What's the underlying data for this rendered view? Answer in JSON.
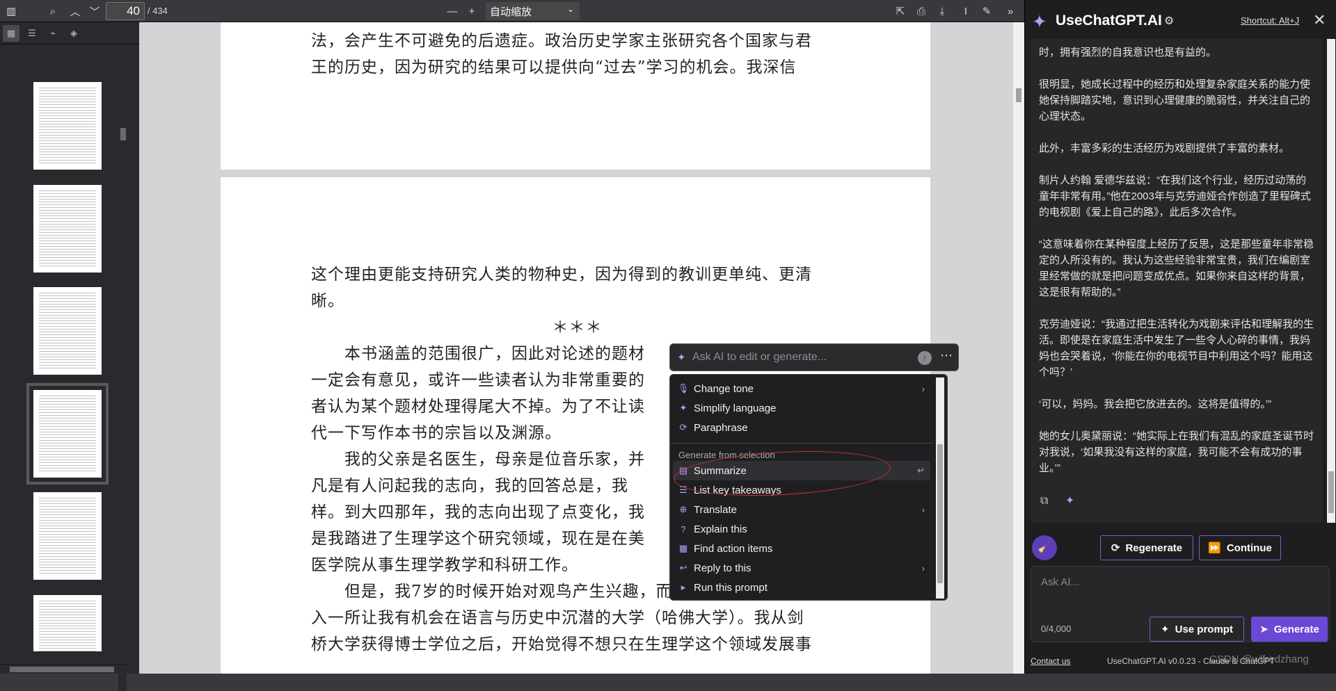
{
  "toolbar": {
    "page_number": "40",
    "page_total": "/ 434",
    "zoom_value": "自动缩放",
    "zoom_out": "—",
    "zoom_in": "+"
  },
  "page1": {
    "lines": [
      "法，会产生不可避免的后遗症。政治历史学家主张研究各个国家与君",
      "王的历史，因为研究的结果可以提供向“过去”学习的机会。我深信"
    ]
  },
  "page2": {
    "lines": [
      "这个理由更能支持研究人类的物种史，因为得到的教训更单纯、更清",
      "晰。",
      "＊＊＊",
      "　　本书涵盖的范围很广，因此对论述的题材",
      "一定会有意见，或许一些读者认为非常重要的",
      "者认为某个题材处理得尾大不掉。为了不让读",
      "代一下写作本书的宗旨以及渊源。",
      "　　我的父亲是名医生，母亲是位音乐家，并",
      "凡是有人问起我的志向，我的回答总是，我",
      "样。到大四那年，我的志向出现了点变化，我",
      "是我踏进了生理学这个研究领域，现在是在美",
      "医学院从事生理学教学和科研工作。",
      "　　但是，我7岁的时候开始对观鸟产生兴趣，而且很幸运地，后来进",
      "入一所让我有机会在语言与历史中沉潜的大学（哈佛大学）。我从剑",
      "桥大学获得博士学位之后，开始觉得不想只在生理学这个领域发展事"
    ]
  },
  "ai_bar": {
    "placeholder": "Ask AI to edit or generate..."
  },
  "menu": {
    "items_top": [
      {
        "label": "Change tone",
        "icon": "microphone-icon",
        "submenu": true
      },
      {
        "label": "Simplify language",
        "icon": "sparkle-icon",
        "submenu": false
      },
      {
        "label": "Paraphrase",
        "icon": "refresh-icon",
        "submenu": false
      }
    ],
    "group_label": "Generate from selection",
    "items_bottom": [
      {
        "label": "Summarize",
        "icon": "document-icon",
        "submenu": false
      },
      {
        "label": "List key takeaways",
        "icon": "list-icon",
        "submenu": false
      },
      {
        "label": "Translate",
        "icon": "globe-icon",
        "submenu": true
      },
      {
        "label": "Explain this",
        "icon": "question-icon",
        "submenu": false
      },
      {
        "label": "Find action items",
        "icon": "checklist-icon",
        "submenu": false
      },
      {
        "label": "Reply to this",
        "icon": "reply-icon",
        "submenu": true
      },
      {
        "label": "Run this prompt",
        "icon": "play-icon",
        "submenu": false
      }
    ]
  },
  "panel": {
    "title": "UseChatGPT.AI",
    "shortcut": "Shortcut: Alt+J",
    "messages": [
      "时，拥有强烈的自我意识也是有益的。",
      "很明显，她成长过程中的经历和处理复杂家庭关系的能力使她保持脚踏实地，意识到心理健康的脆弱性，并关注自己的心理状态。",
      "此外，丰富多彩的生活经历为戏剧提供了丰富的素材。",
      "制片人约翰 爱德华兹说：“在我们这个行业，经历过动荡的童年非常有用。”他在2003年与克劳迪娅合作创造了里程碑式的电视剧《爱上自己的路》，此后多次合作。",
      "“这意味着你在某种程度上经历了反思，这是那些童年非常稳定的人所没有的。我认为这些经验非常宝贵，我们在编剧室里经常做的就是把问题变成优点。如果你来自这样的背景，这是很有帮助的。”",
      "克劳迪娅说：“我通过把生活转化为戏剧来评估和理解我的生活。即使是在家庭生活中发生了一些令人心碎的事情，我妈妈也会哭着说，‘你能在你的电视节目中利用这个吗？能用这个吗？’",
      "‘可以，妈妈。我会把它放进去的。这将是值得的。’”",
      "她的女儿奥黛丽说：“她实际上在我们有混乱的家庭圣诞节时对我说，‘如果我没有这样的家庭，我可能不会有成功的事业。’”"
    ],
    "regenerate": "Regenerate",
    "continue": "Continue",
    "ask_placeholder": "Ask AI...",
    "counter": "0/4,000",
    "use_prompt": "Use prompt",
    "generate": "Generate",
    "contact": "Contact us",
    "version": "UseChatGPT.AI v0.0.23 - Claude & ChatGPT"
  },
  "watermark": "CSDN @wlfredzhang",
  "colors": {
    "accent": "#6b48d6",
    "highlight_ellipse": "#d43030"
  }
}
